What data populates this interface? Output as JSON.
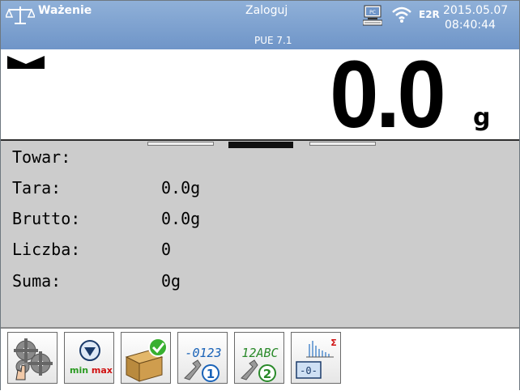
{
  "topbar": {
    "mode": "Ważenie",
    "login": "Zaloguj",
    "device": "PUE 7.1",
    "mode_badge": "E2R",
    "date": "2015.05.07",
    "time": "08:40:44",
    "icons": [
      "scale-icon",
      "pc-connection-icon",
      "wifi-icon"
    ]
  },
  "weight": {
    "value": "0.0",
    "unit": "g",
    "stable_icon": "stability-marker-icon"
  },
  "info": {
    "rows": [
      {
        "label": "Towar:",
        "value": ""
      },
      {
        "label": "Tara:",
        "value": "0.0g"
      },
      {
        "label": "Brutto:",
        "value": "0.0g"
      },
      {
        "label": "Liczba:",
        "value": "0"
      },
      {
        "label": "Suma:",
        "value": "0g"
      }
    ],
    "range_active": 2
  },
  "function_keys": [
    {
      "icon": "settings-gears-icon"
    },
    {
      "icon": "min-max-icon",
      "min_label": "min",
      "max_label": "max"
    },
    {
      "icon": "product-database-icon"
    },
    {
      "icon": "numeric-input-icon",
      "text": "-0123",
      "badge": "1"
    },
    {
      "icon": "alphanumeric-input-icon",
      "text": "12ABC",
      "badge": "2"
    },
    {
      "icon": "statistics-zero-icon",
      "symbol": "Σ",
      "box": "-0-"
    }
  ],
  "colors": {
    "topbar": "#7fa2d0",
    "info_bg": "#cccccc",
    "accent_blue": "#1a63b8",
    "check_green": "#38b030"
  }
}
